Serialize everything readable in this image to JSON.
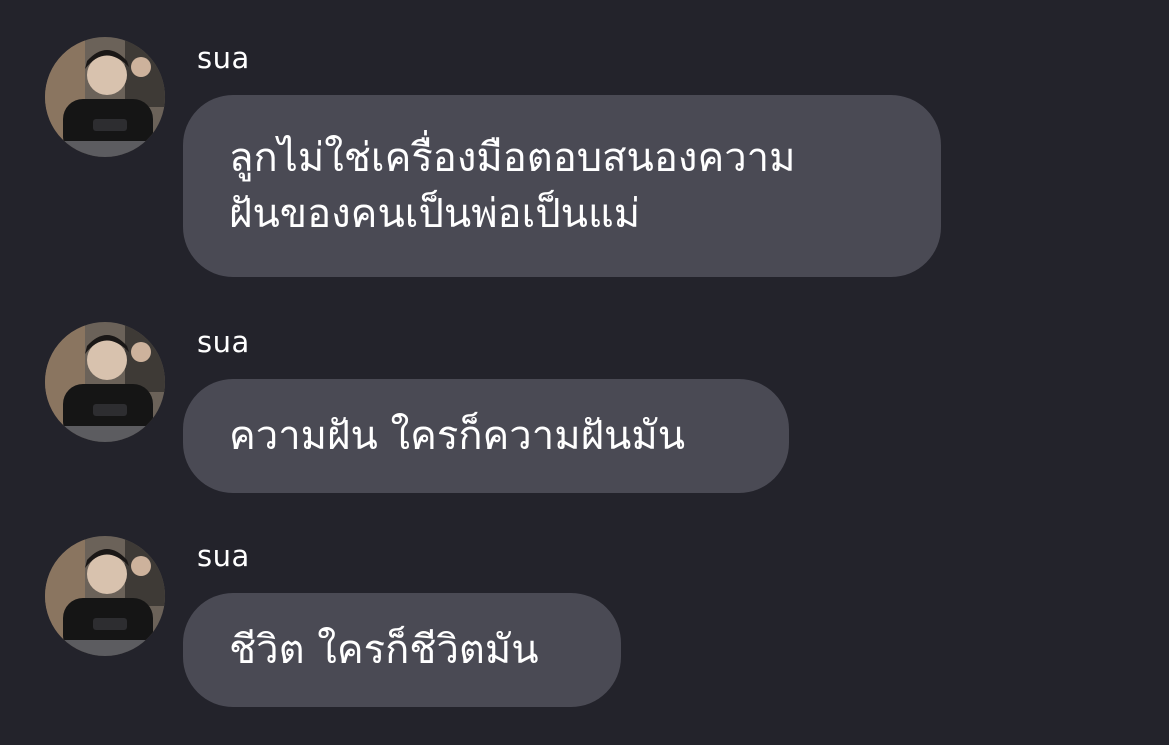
{
  "messages": [
    {
      "sender": "sua",
      "text": "ลูกไม่ใช่เครื่องมือตอบสนองความฝันของคนเป็นพ่อเป็นแม่",
      "lines": [
        "ลูกไม่ใช่เครื่องมือตอบสนองความ",
        "ฝันของคนเป็นพ่อเป็นแม่"
      ]
    },
    {
      "sender": "sua",
      "text": "ความฝัน ใครก็ความฝันมัน",
      "lines": [
        "ความฝัน ใครก็ความฝันมัน"
      ]
    },
    {
      "sender": "sua",
      "text": "ชีวิต ใครก็ชีวิตมัน",
      "lines": [
        "ชีวิต ใครก็ชีวิตมัน"
      ]
    }
  ]
}
